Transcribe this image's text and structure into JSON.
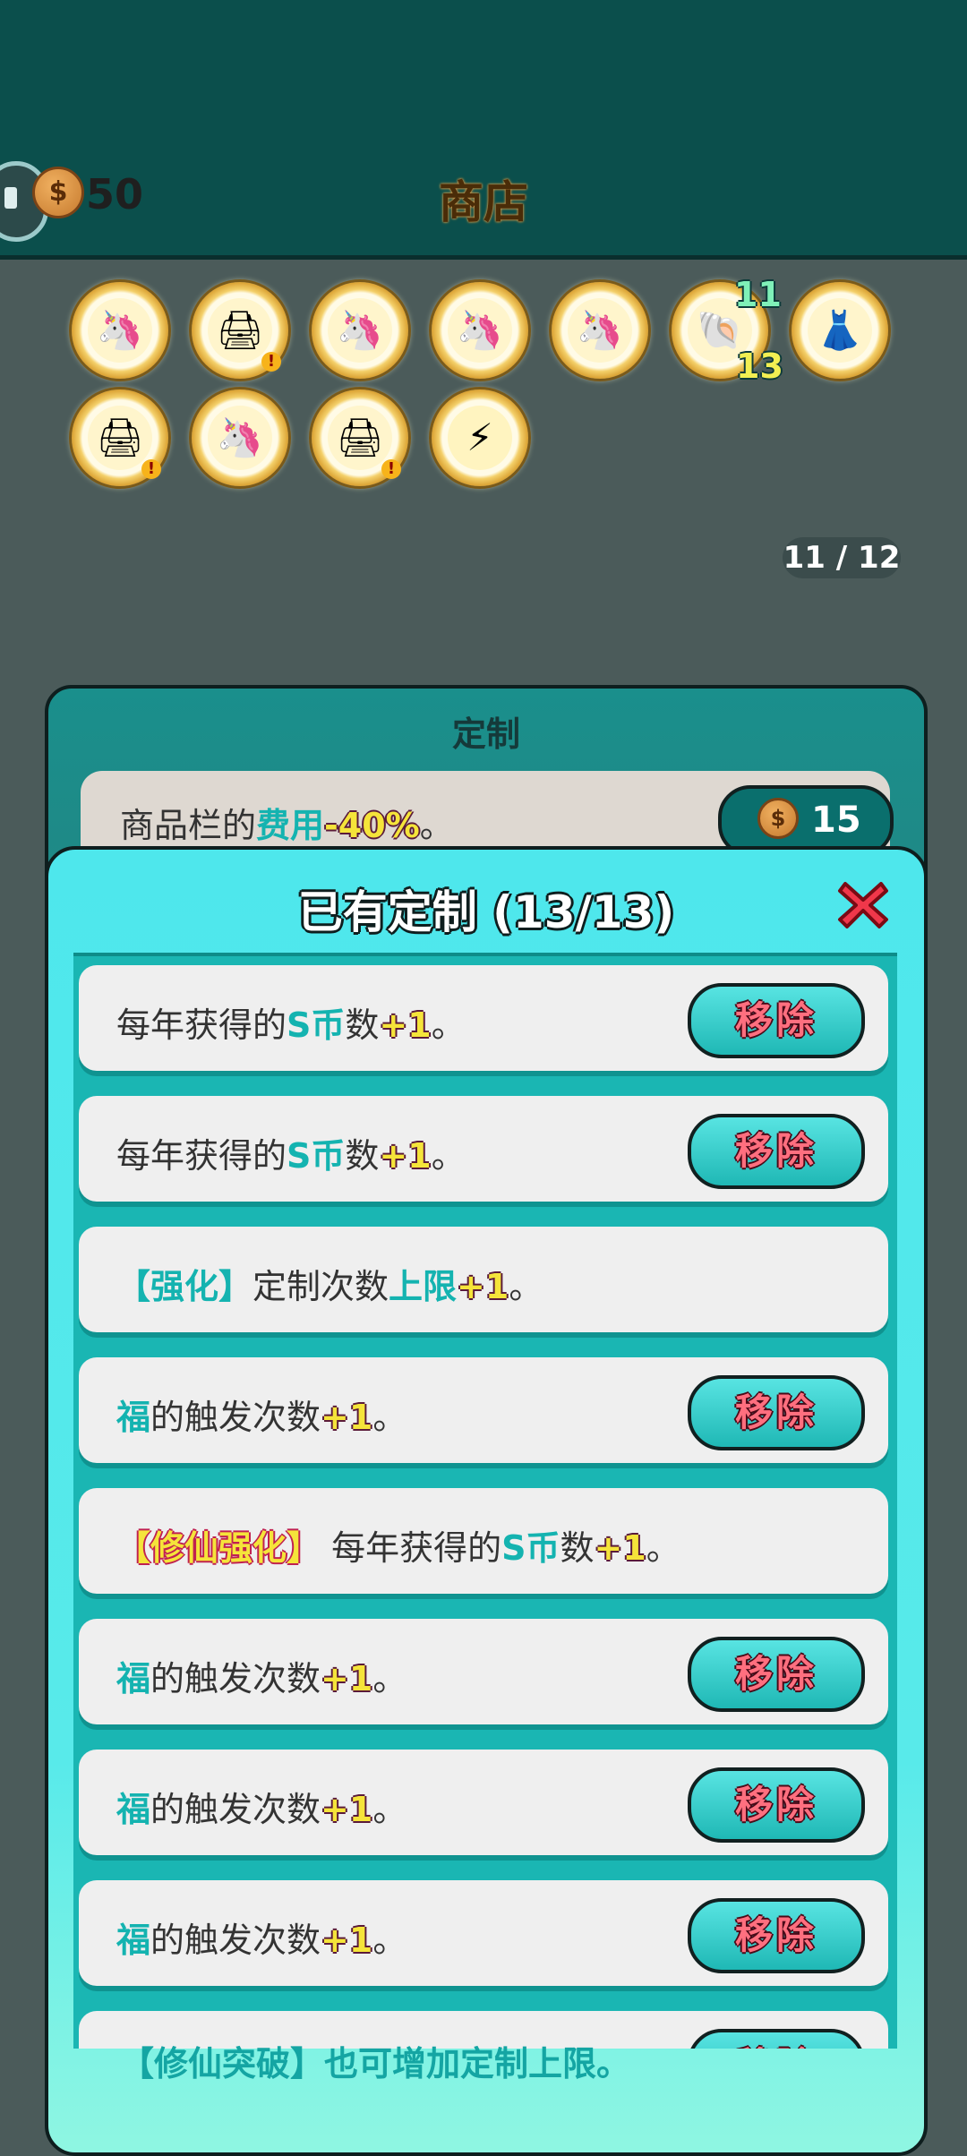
{
  "header": {
    "coin_count": "50",
    "coin_symbol": "$",
    "title": "商店"
  },
  "items": [
    {
      "icon": "unicorn-icon",
      "glyph": "🦄",
      "warn": ""
    },
    {
      "icon": "printer-icon",
      "glyph": "🖨",
      "warn": "!"
    },
    {
      "icon": "unicorn-icon",
      "glyph": "🦄",
      "warn": ""
    },
    {
      "icon": "unicorn-icon",
      "glyph": "🦄",
      "warn": ""
    },
    {
      "icon": "unicorn-icon",
      "glyph": "🦄",
      "warn": ""
    },
    {
      "icon": "shell-icon",
      "glyph": "🐚",
      "warn": ""
    },
    {
      "icon": "skirt-icon",
      "glyph": "👗",
      "warn": ""
    },
    {
      "icon": "printer-icon",
      "glyph": "🖨",
      "warn": "!"
    },
    {
      "icon": "unicorn-icon",
      "glyph": "🦄",
      "warn": ""
    },
    {
      "icon": "printer-icon",
      "glyph": "🖨",
      "warn": "!"
    },
    {
      "icon": "lightning-icon",
      "glyph": "⚡",
      "warn": ""
    }
  ],
  "shell_numbers": {
    "top": "11",
    "bottom": "13"
  },
  "page_indicator": "11 / 12",
  "custom_panel": {
    "title": "定制",
    "row": {
      "prefix": "商品栏的",
      "keyword": "费用",
      "value": "-40%",
      "suffix": "。"
    },
    "cost": "15"
  },
  "modal": {
    "title": "已有定制 (13/13)",
    "remove_label": "移除",
    "cards": [
      {
        "parts": [
          [
            "",
            "每年获得的"
          ],
          [
            "teal",
            "S币"
          ],
          [
            "",
            "数"
          ],
          [
            "yellow",
            "+1"
          ],
          [
            "",
            "。"
          ]
        ],
        "removable": true
      },
      {
        "parts": [
          [
            "",
            "每年获得的"
          ],
          [
            "teal",
            "S币"
          ],
          [
            "",
            "数"
          ],
          [
            "yellow",
            "+1"
          ],
          [
            "",
            "。"
          ]
        ],
        "removable": true
      },
      {
        "parts": [
          [
            "teal",
            "【强化】"
          ],
          [
            "",
            "定制次数"
          ],
          [
            "teal",
            "上限"
          ],
          [
            "yellow",
            "+1"
          ],
          [
            "",
            "。"
          ]
        ],
        "removable": false
      },
      {
        "parts": [
          [
            "teal",
            "福"
          ],
          [
            "",
            "的触发次数"
          ],
          [
            "yellow",
            "+1"
          ],
          [
            "",
            "。"
          ]
        ],
        "removable": true
      },
      {
        "parts": [
          [
            "red",
            "【修仙强化】"
          ],
          [
            "",
            " 每年获得的"
          ],
          [
            "teal",
            "S币"
          ],
          [
            "",
            "数"
          ],
          [
            "yellow",
            "+1"
          ],
          [
            "",
            "。"
          ]
        ],
        "removable": false
      },
      {
        "parts": [
          [
            "teal",
            "福"
          ],
          [
            "",
            "的触发次数"
          ],
          [
            "yellow",
            "+1"
          ],
          [
            "",
            "。"
          ]
        ],
        "removable": true
      },
      {
        "parts": [
          [
            "teal",
            "福"
          ],
          [
            "",
            "的触发次数"
          ],
          [
            "yellow",
            "+1"
          ],
          [
            "",
            "。"
          ]
        ],
        "removable": true
      },
      {
        "parts": [
          [
            "teal",
            "福"
          ],
          [
            "",
            "的触发次数"
          ],
          [
            "yellow",
            "+1"
          ],
          [
            "",
            "。"
          ]
        ],
        "removable": true
      },
      {
        "parts": [],
        "removable": true
      }
    ],
    "footer_note": "【修仙突破】也可增加定制上限。"
  },
  "colors": {
    "teal": "#14b3b0",
    "modal_bg": "#4ee7ec",
    "topbar": "#0b4f4c"
  }
}
